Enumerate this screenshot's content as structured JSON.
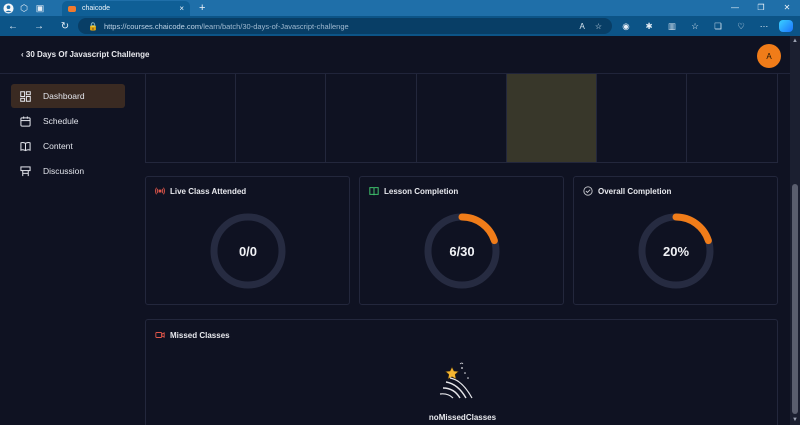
{
  "browser": {
    "tab_title": "chaicode",
    "tab_close": "×",
    "new_tab": "+",
    "url_host": "https://courses.chaicode.com",
    "url_path": "/learn/batch/30-days-of-Javascript-challenge",
    "colors": {
      "tabbar": "#1f6fa9",
      "addressbar": "#0c5487"
    }
  },
  "header": {
    "course_title": "‹ 30 Days Of Javascript Challenge",
    "avatar_initial": "A",
    "avatar_color": "#f07c19"
  },
  "sidebar": {
    "items": [
      {
        "label": "Dashboard",
        "icon": "dashboard-icon",
        "active": true
      },
      {
        "label": "Schedule",
        "icon": "calendar-icon",
        "active": false
      },
      {
        "label": "Content",
        "icon": "book-icon",
        "active": false
      },
      {
        "label": "Discussion",
        "icon": "discussion-icon",
        "active": false
      }
    ]
  },
  "stats": [
    {
      "title": "Live Class Attended",
      "icon": "broadcast-icon",
      "value_text": "0/0",
      "progress": 0,
      "icon_color": "#e0564a"
    },
    {
      "title": "Lesson Completion",
      "icon": "open-book-icon",
      "value_text": "6/30",
      "progress": 0.2,
      "icon_color": "#3fbf6b"
    },
    {
      "title": "Overall Completion",
      "icon": "check-circle-icon",
      "value_text": "20%",
      "progress": 0.2,
      "icon_color": "#c8c9cf"
    }
  ],
  "missed_classes": {
    "title": "Missed Classes",
    "icon": "video-icon",
    "empty_label": "noMissedClasses"
  },
  "colors": {
    "accent": "#f07c19",
    "ring_track": "#262b41",
    "background": "#0f1222"
  }
}
